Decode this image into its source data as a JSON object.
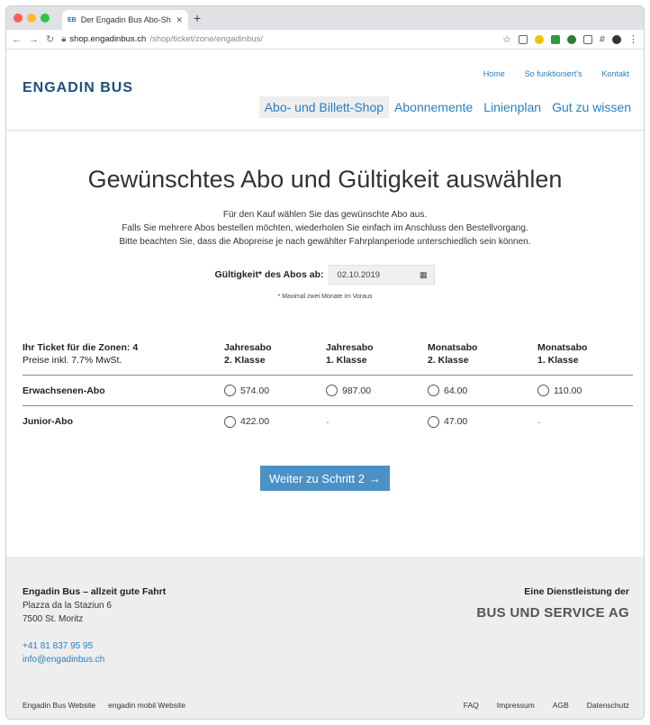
{
  "browser": {
    "tab_title": "Der Engadin Bus Abo-Shop für",
    "url_host": "shop.engadinbus.ch",
    "url_path": "/shop/ticket/zone/engadinbus/"
  },
  "header": {
    "logo": "ENGADIN BUS",
    "top_links": [
      "Home",
      "So funktioniert's",
      "Kontakt"
    ],
    "nav": [
      "Abo- und Billett-Shop",
      "Abonnemente",
      "Linienplan",
      "Gut zu wissen"
    ]
  },
  "main": {
    "title": "Gewünschtes Abo und Gültigkeit auswählen",
    "intro": [
      "Für den Kauf wählen Sie das gewünschte Abo aus.",
      "Falls Sie mehrere Abos bestellen möchten, wiederholen Sie einfach im Anschluss den Bestellvorgang.",
      "Bitte beachten Sie, dass die Abopreise je nach gewählter Fahrplanperiode unterschiedlich sein können."
    ],
    "validity_label": "Gültigkeit* des Abos ab:",
    "validity_date": "02.10.2019",
    "note": "* Maximal zwei Monate im Voraus",
    "table": {
      "zone_label": "Ihr Ticket für die Zonen: 4",
      "price_note": "Preise inkl. 7.7% MwSt.",
      "columns": [
        {
          "line1": "Jahresabo",
          "line2": "2. Klasse"
        },
        {
          "line1": "Jahresabo",
          "line2": "1. Klasse"
        },
        {
          "line1": "Monatsabo",
          "line2": "2. Klasse"
        },
        {
          "line1": "Monatsabo",
          "line2": "1. Klasse"
        }
      ],
      "rows": [
        {
          "label": "Erwachsenen-Abo",
          "prices": [
            "574.00",
            "987.00",
            "64.00",
            "110.00"
          ]
        },
        {
          "label": "Junior-Abo",
          "prices": [
            "422.00",
            "-",
            "47.00",
            "-"
          ]
        }
      ]
    },
    "next_button": "Weiter zu Schritt 2"
  },
  "footer": {
    "company": "Engadin Bus – allzeit gute Fahrt",
    "address_line1": "Plazza da la Staziun 6",
    "address_line2": "7500 St. Moritz",
    "phone": "+41 81 837 95 95",
    "email": "info@engadinbus.ch",
    "service_label": "Eine Dienstleistung der",
    "service_brand": "BUS UND SERVICE AG",
    "left_links": [
      "Engadin Bus Website",
      "engadin mobil Website"
    ],
    "right_links": [
      "FAQ",
      "Impressum",
      "AGB",
      "Datenschutz"
    ]
  },
  "colors": {
    "accent": "#2a7fbf",
    "button": "#4b91c5",
    "logo": "#1d4f7d",
    "footer_bg": "#eeeeee"
  }
}
